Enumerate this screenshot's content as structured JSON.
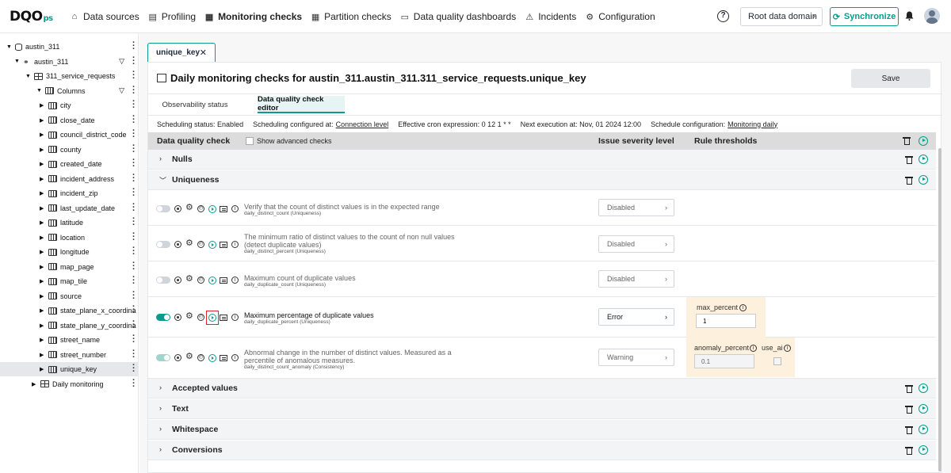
{
  "app": {
    "logo_main": "DQO",
    "logo_sub": "ps"
  },
  "nav": [
    {
      "label": "Data sources",
      "icon": "database-icon",
      "bold": false
    },
    {
      "label": "Profiling",
      "icon": "profiling-icon",
      "bold": false
    },
    {
      "label": "Monitoring checks",
      "icon": "monitoring-icon",
      "bold": true
    },
    {
      "label": "Partition checks",
      "icon": "partition-icon",
      "bold": false
    },
    {
      "label": "Data quality dashboards",
      "icon": "dashboard-icon",
      "bold": false
    },
    {
      "label": "Incidents",
      "icon": "warning-icon",
      "bold": false
    },
    {
      "label": "Configuration",
      "icon": "gear-icon",
      "bold": false
    }
  ],
  "header": {
    "help": "?",
    "domain": "Root data domain",
    "sync": "Synchronize"
  },
  "tree": [
    {
      "label": "austin_311",
      "icon": "database",
      "level": 0,
      "expanded": true,
      "filter": false
    },
    {
      "label": "austin_311",
      "icon": "schema",
      "level": 1,
      "expanded": true,
      "filter": true
    },
    {
      "label": "311_service_requests",
      "icon": "table",
      "level": 2,
      "expanded": true,
      "filter": false
    },
    {
      "label": "Columns",
      "icon": "columns",
      "level": 3,
      "expanded": true,
      "filter": true
    },
    {
      "label": "city",
      "icon": "column",
      "level": 4
    },
    {
      "label": "close_date",
      "icon": "column",
      "level": 4
    },
    {
      "label": "council_district_code",
      "icon": "column",
      "level": 4
    },
    {
      "label": "county",
      "icon": "column",
      "level": 4
    },
    {
      "label": "created_date",
      "icon": "column",
      "level": 4
    },
    {
      "label": "incident_address",
      "icon": "column",
      "level": 4
    },
    {
      "label": "incident_zip",
      "icon": "column",
      "level": 4
    },
    {
      "label": "last_update_date",
      "icon": "column",
      "level": 4
    },
    {
      "label": "latitude",
      "icon": "column",
      "level": 4
    },
    {
      "label": "location",
      "icon": "column",
      "level": 4
    },
    {
      "label": "longitude",
      "icon": "column",
      "level": 4
    },
    {
      "label": "map_page",
      "icon": "column",
      "level": 4
    },
    {
      "label": "map_tile",
      "icon": "column",
      "level": 4
    },
    {
      "label": "source",
      "icon": "column",
      "level": 4
    },
    {
      "label": "state_plane_x_coordina",
      "icon": "column",
      "level": 4
    },
    {
      "label": "state_plane_y_coordina",
      "icon": "column",
      "level": 4
    },
    {
      "label": "street_name",
      "icon": "column",
      "level": 4
    },
    {
      "label": "street_number",
      "icon": "column",
      "level": 4
    },
    {
      "label": "unique_key",
      "icon": "column",
      "level": 4,
      "selected": true
    },
    {
      "label": "Daily monitoring",
      "icon": "table",
      "level": 3
    }
  ],
  "tab": {
    "label": "unique_key",
    "close": "✕"
  },
  "page": {
    "title": "Daily monitoring checks for austin_311.austin_311.311_service_requests.unique_key",
    "save": "Save",
    "subtabs": [
      "Observability status",
      "Data quality check editor"
    ]
  },
  "schedule": {
    "status": "Scheduling status: Enabled",
    "configured_prefix": "Scheduling configured at:",
    "configured_link": "Connection level",
    "cron": "Effective cron expression: 0 12 1 * *",
    "next": "Next execution at: Nov, 01 2024 12:00",
    "config_prefix": "Schedule configuration:",
    "config_link": "Monitoring daily"
  },
  "table_header": {
    "check": "Data quality check",
    "advanced": "Show advanced checks",
    "severity": "Issue severity level",
    "rules": "Rule thresholds"
  },
  "categories": [
    {
      "label": "Nulls",
      "expanded": false
    },
    {
      "label": "Uniqueness",
      "expanded": true
    },
    {
      "label": "Accepted values",
      "expanded": false
    },
    {
      "label": "Text",
      "expanded": false
    },
    {
      "label": "Whitespace",
      "expanded": false
    },
    {
      "label": "Conversions",
      "expanded": false
    }
  ],
  "checks": [
    {
      "desc": "Verify that the count of distinct values is in the expected range",
      "code": "daily_distinct_count (Uniqueness)",
      "severity": "Disabled",
      "enabled": false
    },
    {
      "desc": "The minimum ratio of distinct values to the count of non null values (detect duplicate values)",
      "code": "daily_distinct_percent (Uniqueness)",
      "severity": "Disabled",
      "enabled": false
    },
    {
      "desc": "Maximum count of duplicate values",
      "code": "daily_duplicate_count (Uniqueness)",
      "severity": "Disabled",
      "enabled": false
    },
    {
      "desc": "Maximum percentage of duplicate values",
      "code": "daily_duplicate_percent (Uniqueness)",
      "severity": "Error",
      "enabled": true,
      "rule_label": "max_percent",
      "rule_value": "1"
    },
    {
      "desc": "Abnormal change in the number of distinct values. Measured as a percentile of anomalous measures.",
      "code": "daily_distinct_count_anomaly (Consistency)",
      "severity": "Warning",
      "enabled": true,
      "rule_label": "anomaly_percent",
      "rule_value": "0.1",
      "rule_label2": "use_ai"
    }
  ],
  "colors": {
    "accent": "#0a9b8c",
    "highlight": "#dc2626",
    "rule_bg": "#fdf0dc"
  }
}
